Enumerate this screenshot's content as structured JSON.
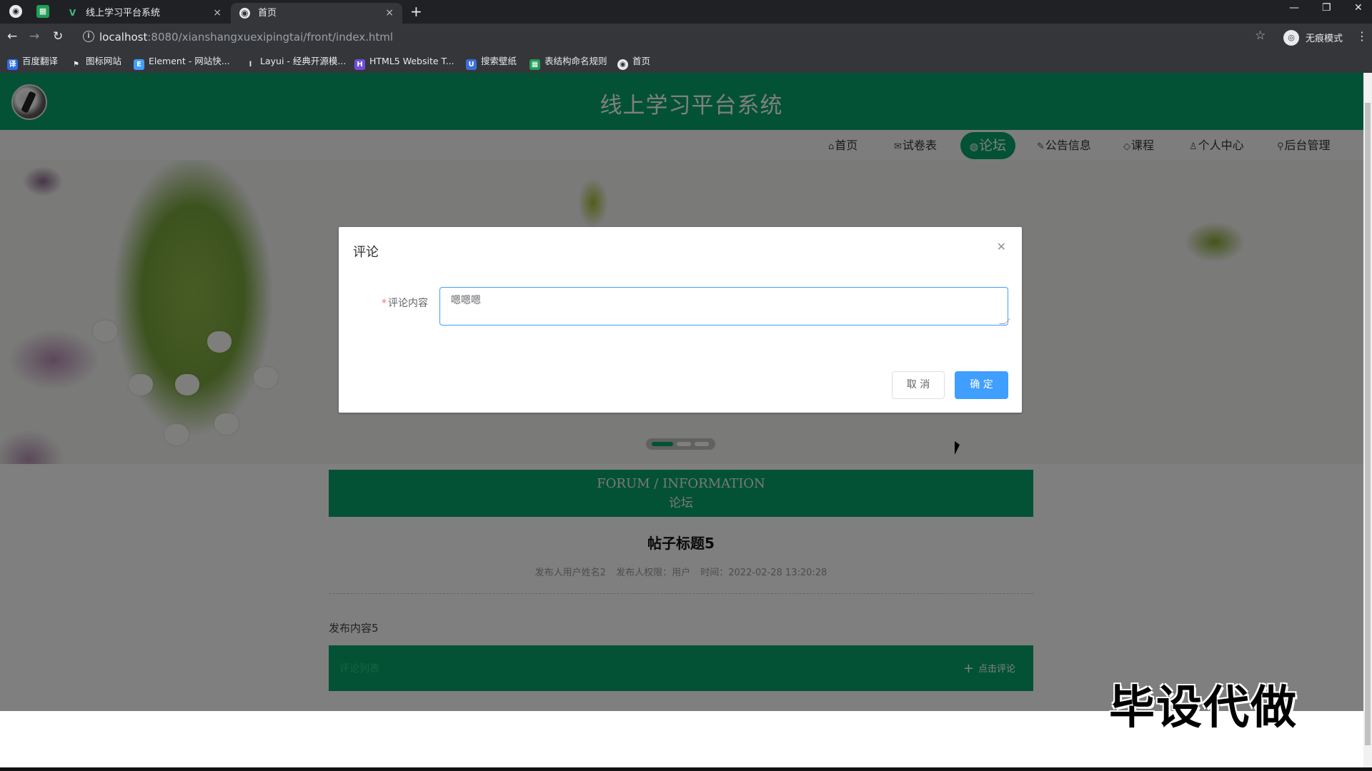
{
  "browser": {
    "tabs": [
      {
        "title": "线上学习平台系统",
        "close": "×"
      },
      {
        "title": "首页",
        "close": "×"
      }
    ],
    "new_tab": "+",
    "window_controls": {
      "minimize": "—",
      "restore": "❐",
      "close": "✕"
    },
    "url_host": "localhost",
    "url_path": ":8080/xianshangxuexipingtai/front/index.html",
    "profile_label": "无痕模式",
    "bookmarks": [
      {
        "label": "百度翻译",
        "color": "#2b6de8"
      },
      {
        "label": "图标网站",
        "color": "#444444"
      },
      {
        "label": "Element - 网站快...",
        "color": "#409eff"
      },
      {
        "label": "Layui - 经典开源模...",
        "color": "#444444"
      },
      {
        "label": "HTML5 Website T...",
        "color": "#6f4fd8"
      },
      {
        "label": "搜索壁纸",
        "color": "#3a6fd8"
      },
      {
        "label": "表结构命名规则",
        "color": "#1e9e55"
      },
      {
        "label": "首页",
        "color": "#e8eaed"
      }
    ]
  },
  "site": {
    "title": "线上学习平台系统",
    "accent_color": "#07a56a",
    "nav": [
      {
        "label": "首页",
        "icon": "home-icon"
      },
      {
        "label": "试卷表",
        "icon": "mail-icon"
      },
      {
        "label": "论坛",
        "icon": "globe-icon",
        "active": true
      },
      {
        "label": "公告信息",
        "icon": "edit-icon"
      },
      {
        "label": "课程",
        "icon": "tag-icon"
      },
      {
        "label": "个人中心",
        "icon": "user-icon"
      },
      {
        "label": "后台管理",
        "icon": "link-icon"
      }
    ]
  },
  "forum": {
    "banner_en": "FORUM / INFORMATION",
    "banner_cn": "论坛",
    "post_title": "帖子标题5",
    "meta_user": "发布人用户姓名2",
    "meta_role": "发布人权限：用户",
    "meta_time": "时间：2022-02-28 13:20:28",
    "post_content": "发布内容5",
    "comment_list_label": "评论列表",
    "comment_button": "点击评论"
  },
  "dialog": {
    "title": "评论",
    "field_label": "评论内容",
    "field_value": "嗯嗯嗯",
    "cancel": "取 消",
    "confirm": "确 定",
    "confirm_color": "#409eff"
  },
  "watermark": "毕设代做"
}
